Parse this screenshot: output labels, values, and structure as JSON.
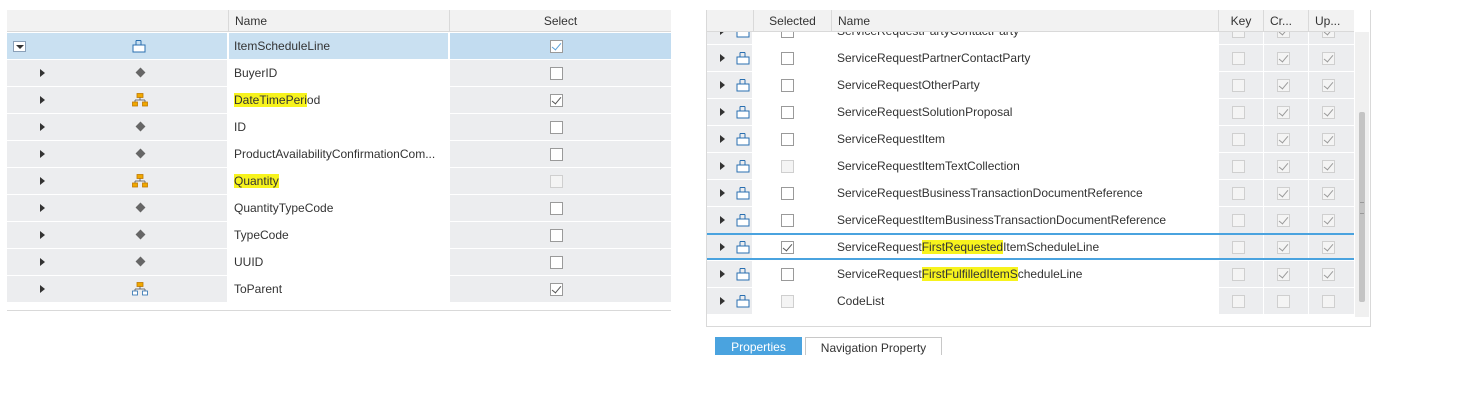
{
  "left_table": {
    "headers": {
      "name": "Name",
      "select": "Select"
    },
    "rows": [
      {
        "name": "ItemScheduleLine",
        "icon": "entity-icon",
        "expand": "expanded",
        "select": true,
        "selected_row": true
      },
      {
        "name": "BuyerID",
        "icon": "attribute-icon",
        "expand": "collapsed",
        "select": false
      },
      {
        "name_pre": "",
        "name_hl": "DateTimePeri",
        "name_post": "od",
        "icon": "hierarchy-icon",
        "expand": "collapsed",
        "select": true
      },
      {
        "name": "ID",
        "icon": "attribute-icon",
        "expand": "collapsed",
        "select": false
      },
      {
        "name": "ProductAvailabilityConfirmationCom...",
        "icon": "attribute-icon",
        "expand": "collapsed",
        "select": false
      },
      {
        "name_pre": "",
        "name_hl": "Quantity",
        "name_post": "",
        "icon": "hierarchy-icon",
        "expand": "collapsed",
        "select": false,
        "select_disabled": true
      },
      {
        "name": "QuantityTypeCode",
        "icon": "attribute-icon",
        "expand": "collapsed",
        "select": false
      },
      {
        "name": "TypeCode",
        "icon": "attribute-icon",
        "expand": "collapsed",
        "select": false
      },
      {
        "name": "UUID",
        "icon": "attribute-icon",
        "expand": "collapsed",
        "select": false
      },
      {
        "name": "ToParent",
        "icon": "association-icon",
        "expand": "collapsed",
        "select": true
      }
    ]
  },
  "right_table": {
    "headers": {
      "selected": "Selected",
      "name": "Name",
      "key": "Key",
      "create": "Cr...",
      "update": "Up..."
    },
    "rows": [
      {
        "name": "ServiceRequestPartyContactParty",
        "selected": false,
        "key": false,
        "create": true,
        "update": true,
        "partial": true
      },
      {
        "name": "ServiceRequestPartnerContactParty",
        "selected": false,
        "key": false,
        "create": true,
        "update": true
      },
      {
        "name": "ServiceRequestOtherParty",
        "selected": false,
        "key": false,
        "create": true,
        "update": true
      },
      {
        "name": "ServiceRequestSolutionProposal",
        "selected": false,
        "key": false,
        "create": true,
        "update": true
      },
      {
        "name": "ServiceRequestItem",
        "selected": false,
        "key": false,
        "create": true,
        "update": true
      },
      {
        "name": "ServiceRequestItemTextCollection",
        "selected": false,
        "selected_disabled": true,
        "key": false,
        "create": true,
        "update": true
      },
      {
        "name": "ServiceRequestBusinessTransactionDocumentReference",
        "selected": false,
        "key": false,
        "create": true,
        "update": true
      },
      {
        "name": "ServiceRequestItemBusinessTransactionDocumentReference",
        "selected": false,
        "key": false,
        "create": true,
        "update": true
      },
      {
        "name_pre": "ServiceRequest",
        "name_hl": "FirstRequested",
        "name_post": "ItemScheduleLine",
        "selected": true,
        "key": false,
        "create": true,
        "update": true,
        "focused": true
      },
      {
        "name_pre": "ServiceRequest",
        "name_hl": "FirstFulfilledItemS",
        "name_post": "cheduleLine",
        "selected": false,
        "key": false,
        "create": true,
        "update": true
      },
      {
        "name": "CodeList",
        "selected": false,
        "selected_disabled": true,
        "key": false,
        "create": false,
        "update": false
      }
    ]
  },
  "tabs": [
    {
      "label": "Properties",
      "active": true
    },
    {
      "label": "Navigation Property",
      "active": false
    }
  ],
  "colors": {
    "highlight": "#f7f31d",
    "selected_row": "#c9e0f1",
    "focus_border": "#4aa3df",
    "tab_active": "#4aa3df"
  }
}
